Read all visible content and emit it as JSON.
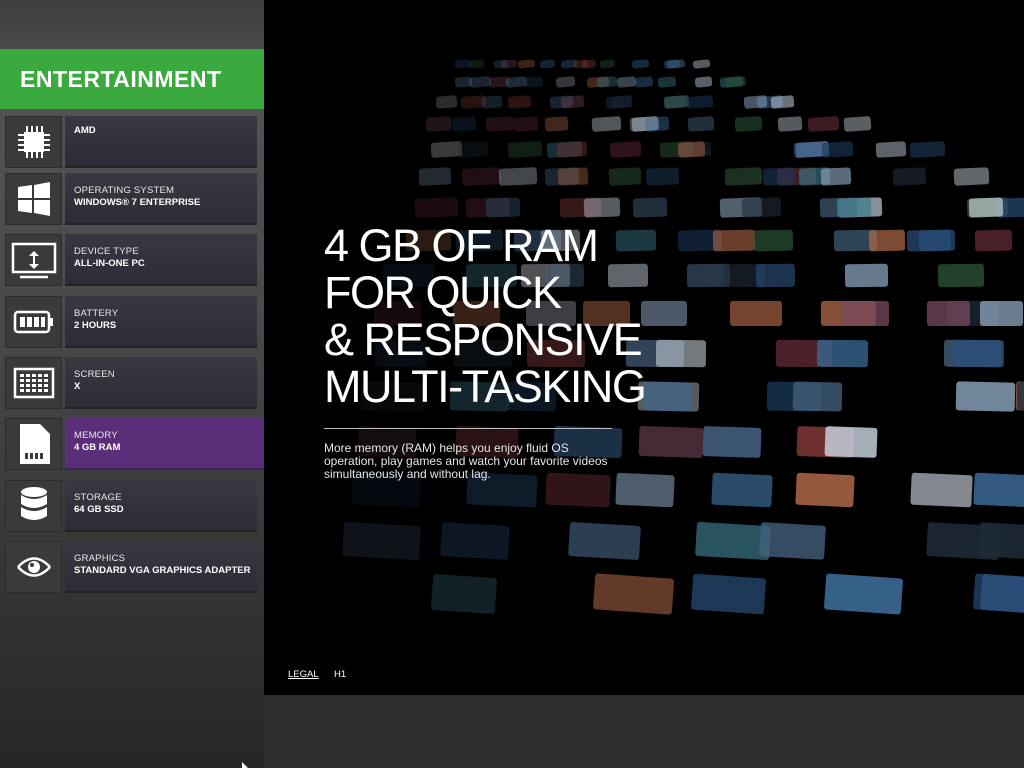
{
  "sidebar": {
    "category": "ENTERTAINMENT",
    "specs": [
      {
        "label": "",
        "value": "AMD",
        "icon": "processor-chip-icon"
      },
      {
        "label": "OPERATING SYSTEM",
        "value": "WINDOWS® 7 ENTERPRISE",
        "icon": "windows-logo-icon"
      },
      {
        "label": "DEVICE TYPE",
        "value": "ALL-IN-ONE PC",
        "icon": "all-in-one-monitor-icon"
      },
      {
        "label": "BATTERY",
        "value": "2 HOURS",
        "icon": "battery-icon"
      },
      {
        "label": "SCREEN",
        "value": "X",
        "icon": "screen-grid-icon"
      },
      {
        "label": "MEMORY",
        "value": "4 GB RAM",
        "icon": "memory-card-icon",
        "active": true
      },
      {
        "label": "STORAGE",
        "value": "64 GB SSD",
        "icon": "storage-database-icon"
      },
      {
        "label": "GRAPHICS",
        "value": "STANDARD VGA GRAPHICS ADAPTER",
        "icon": "graphics-eye-icon"
      }
    ]
  },
  "main": {
    "headline_lines": [
      "4 GB OF RAM",
      "FOR QUICK",
      "& RESPONSIVE",
      "MULTI-TASKING"
    ],
    "description": "More memory (RAM) helps you enjoy fluid OS operation, play games and watch your favorite videos simultaneously and without lag.",
    "footer": {
      "legal_label": "LEGAL",
      "code": "H1"
    }
  },
  "colors": {
    "category_green": "#3aa93e",
    "active_purple": "#5a2e78",
    "spec_box": "#332f3a"
  }
}
